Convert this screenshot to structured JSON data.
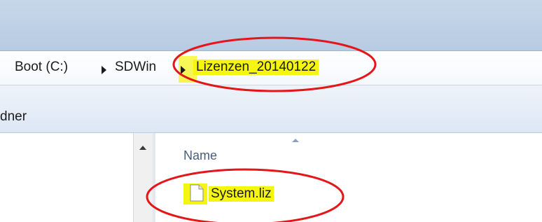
{
  "breadcrumb": {
    "items": [
      "Boot (C:)",
      "SDWin",
      "Lizenzen_20140122"
    ]
  },
  "toolbar": {
    "label": "dner"
  },
  "file_list": {
    "column_header": "Name",
    "files": [
      {
        "name": "System.liz",
        "icon": "document-icon"
      }
    ]
  },
  "colors": {
    "highlight": "#f5f50f",
    "annotation_circle": "#e4161a",
    "title_bar": "#bfd1e6"
  }
}
